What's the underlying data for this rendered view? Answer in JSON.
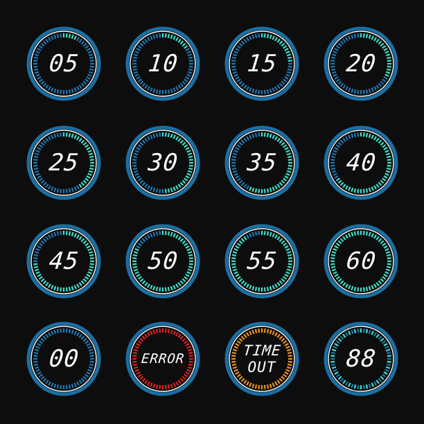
{
  "colors": {
    "background": "#0d0d0d",
    "outer_ring": "#1a6fa3",
    "inner_ring": "#ffffff",
    "tick_inactive": "#1e78b4",
    "tick_active": "#3fe0c8",
    "tick_error": "#e02020",
    "tick_timeout": "#f0921e",
    "text": "#ffffff"
  },
  "timers": [
    {
      "line1": "05",
      "line2": "",
      "progress_seconds": 5,
      "total_seconds": 60,
      "style": "normal"
    },
    {
      "line1": "10",
      "line2": "",
      "progress_seconds": 10,
      "total_seconds": 60,
      "style": "normal"
    },
    {
      "line1": "15",
      "line2": "",
      "progress_seconds": 15,
      "total_seconds": 60,
      "style": "normal"
    },
    {
      "line1": "20",
      "line2": "",
      "progress_seconds": 20,
      "total_seconds": 60,
      "style": "normal"
    },
    {
      "line1": "25",
      "line2": "",
      "progress_seconds": 25,
      "total_seconds": 60,
      "style": "normal"
    },
    {
      "line1": "30",
      "line2": "",
      "progress_seconds": 30,
      "total_seconds": 60,
      "style": "normal"
    },
    {
      "line1": "35",
      "line2": "",
      "progress_seconds": 35,
      "total_seconds": 60,
      "style": "normal"
    },
    {
      "line1": "40",
      "line2": "",
      "progress_seconds": 40,
      "total_seconds": 60,
      "style": "normal"
    },
    {
      "line1": "45",
      "line2": "",
      "progress_seconds": 45,
      "total_seconds": 60,
      "style": "normal"
    },
    {
      "line1": "50",
      "line2": "",
      "progress_seconds": 50,
      "total_seconds": 60,
      "style": "normal"
    },
    {
      "line1": "55",
      "line2": "",
      "progress_seconds": 55,
      "total_seconds": 60,
      "style": "normal"
    },
    {
      "line1": "60",
      "line2": "",
      "progress_seconds": 60,
      "total_seconds": 60,
      "style": "normal"
    },
    {
      "line1": "00",
      "line2": "",
      "progress_seconds": 0,
      "total_seconds": 60,
      "style": "normal"
    },
    {
      "line1": "ERROR",
      "line2": "",
      "progress_seconds": 60,
      "total_seconds": 60,
      "style": "error"
    },
    {
      "line1": "TIME",
      "line2": "OUT",
      "progress_seconds": 60,
      "total_seconds": 60,
      "style": "timeout"
    },
    {
      "line1": "88",
      "line2": "",
      "progress_seconds": 60,
      "total_seconds": 60,
      "style": "full-alt"
    }
  ]
}
